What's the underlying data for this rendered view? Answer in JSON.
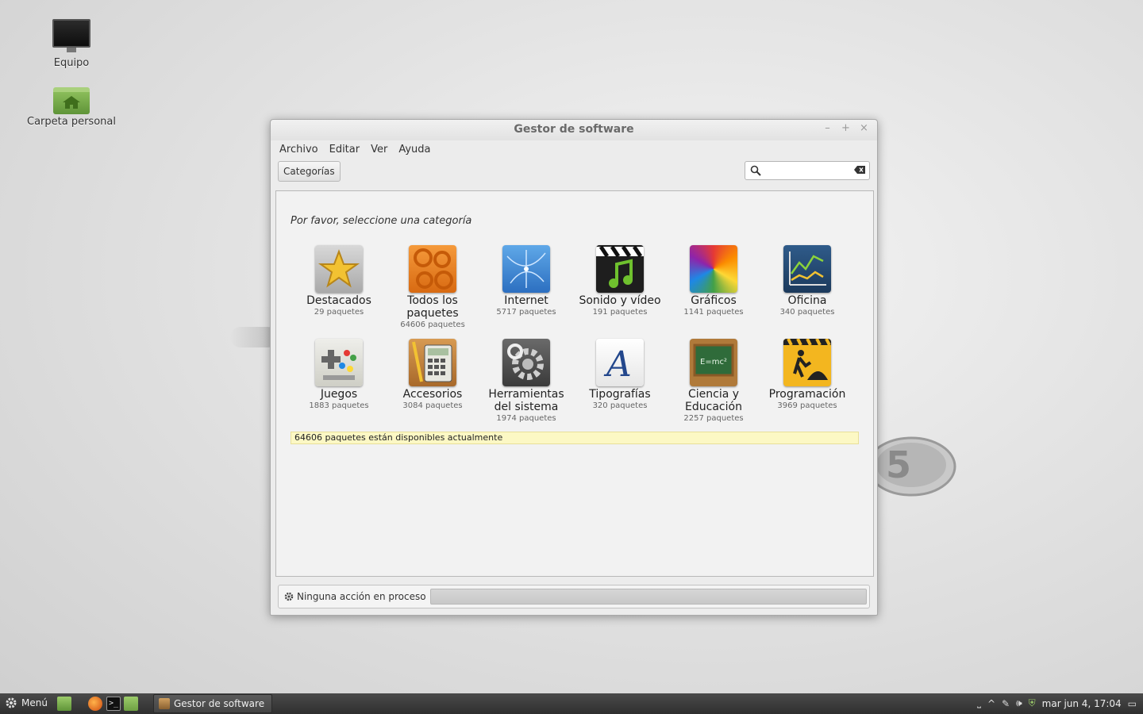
{
  "desktop": {
    "icons": [
      {
        "label": "Equipo"
      },
      {
        "label": "Carpeta personal"
      }
    ]
  },
  "window": {
    "title": "Gestor de software",
    "buttons": {
      "minimize": "–",
      "maximize": "+",
      "close": "×"
    },
    "menu": [
      "Archivo",
      "Editar",
      "Ver",
      "Ayuda"
    ],
    "toolbar": {
      "categories_button": "Categorías",
      "search_value": ""
    },
    "main": {
      "prompt": "Por favor, seleccione una categoría",
      "categories": [
        {
          "name": "Destacados",
          "count": "29 paquetes",
          "icon": "star-icon"
        },
        {
          "name": "Todos los paquetes",
          "count": "64606 paquetes",
          "icon": "gears-icon"
        },
        {
          "name": "Internet",
          "count": "5717 paquetes",
          "icon": "globe-icon"
        },
        {
          "name": "Sonido y vídeo",
          "count": "191 paquetes",
          "icon": "clapperboard-icon"
        },
        {
          "name": "Gráficos",
          "count": "1141 paquetes",
          "icon": "color-wheel-icon"
        },
        {
          "name": "Oficina",
          "count": "340 paquetes",
          "icon": "chart-icon"
        },
        {
          "name": "Juegos",
          "count": "1883 paquetes",
          "icon": "gamepad-icon"
        },
        {
          "name": "Accesorios",
          "count": "3084 paquetes",
          "icon": "calculator-icon"
        },
        {
          "name": "Herramientas del sistema",
          "count": "1974 paquetes",
          "icon": "system-gear-icon"
        },
        {
          "name": "Tipografías",
          "count": "320 paquetes",
          "icon": "font-icon"
        },
        {
          "name": "Ciencia y Educación",
          "count": "2257 paquetes",
          "icon": "chalkboard-icon"
        },
        {
          "name": "Programación",
          "count": "3969 paquetes",
          "icon": "construction-icon"
        }
      ],
      "available_msg": "64606 paquetes están disponibles actualmente"
    },
    "footer": {
      "status": "Ninguna acción en proceso"
    }
  },
  "taskbar": {
    "menu_label": "Menú",
    "task": "Gestor de software",
    "clock": "mar jun  4, 17:04"
  },
  "colors": {
    "highlight": "#fcf8c4",
    "mint_green": "#87b84a"
  }
}
